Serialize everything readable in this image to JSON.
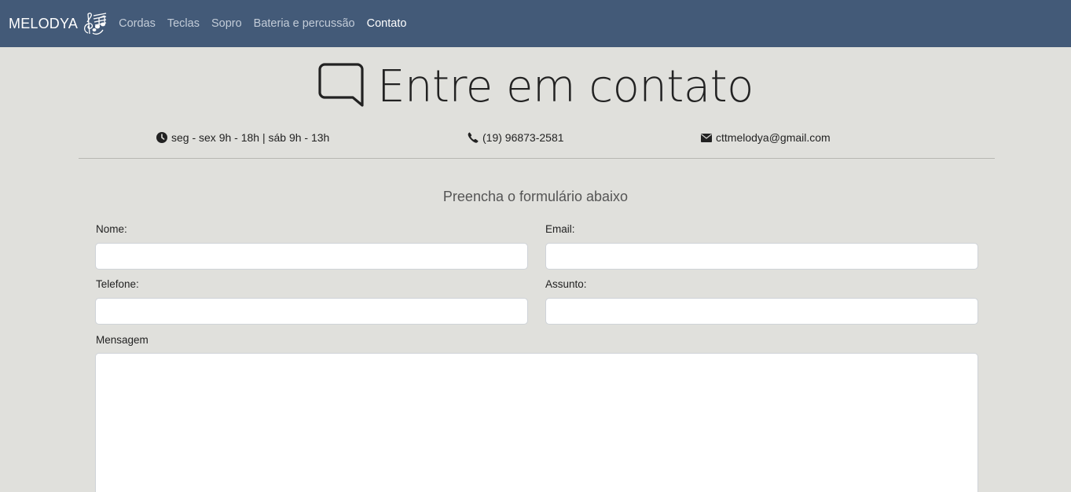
{
  "nav": {
    "brand": "MELODYA",
    "links": [
      {
        "label": "Cordas",
        "active": false
      },
      {
        "label": "Teclas",
        "active": false
      },
      {
        "label": "Sopro",
        "active": false
      },
      {
        "label": "Bateria e percussão",
        "active": false
      },
      {
        "label": "Contato",
        "active": true
      }
    ],
    "colors": {
      "background": "#435a78",
      "link": "#c3ccd8",
      "active": "#ffffff"
    }
  },
  "hero": {
    "title": "Entre em contato",
    "icon": "chat-bubble-icon"
  },
  "info": {
    "hours": {
      "icon": "clock-icon",
      "text": "seg - sex 9h - 18h | sáb 9h - 13h"
    },
    "phone": {
      "icon": "phone-icon",
      "text": "(19) 96873-2581"
    },
    "email": {
      "icon": "envelope-icon",
      "text": "cttmelodya@gmail.com"
    }
  },
  "form": {
    "subtitle": "Preencha o formulário abaixo",
    "fields": {
      "nome": {
        "label": "Nome:",
        "value": ""
      },
      "email": {
        "label": "Email:",
        "value": ""
      },
      "telefone": {
        "label": "Telefone:",
        "value": ""
      },
      "assunto": {
        "label": "Assunto:",
        "value": ""
      },
      "mensagem": {
        "label": "Mensagem",
        "value": ""
      }
    }
  },
  "page_background": "#e0e0dc"
}
